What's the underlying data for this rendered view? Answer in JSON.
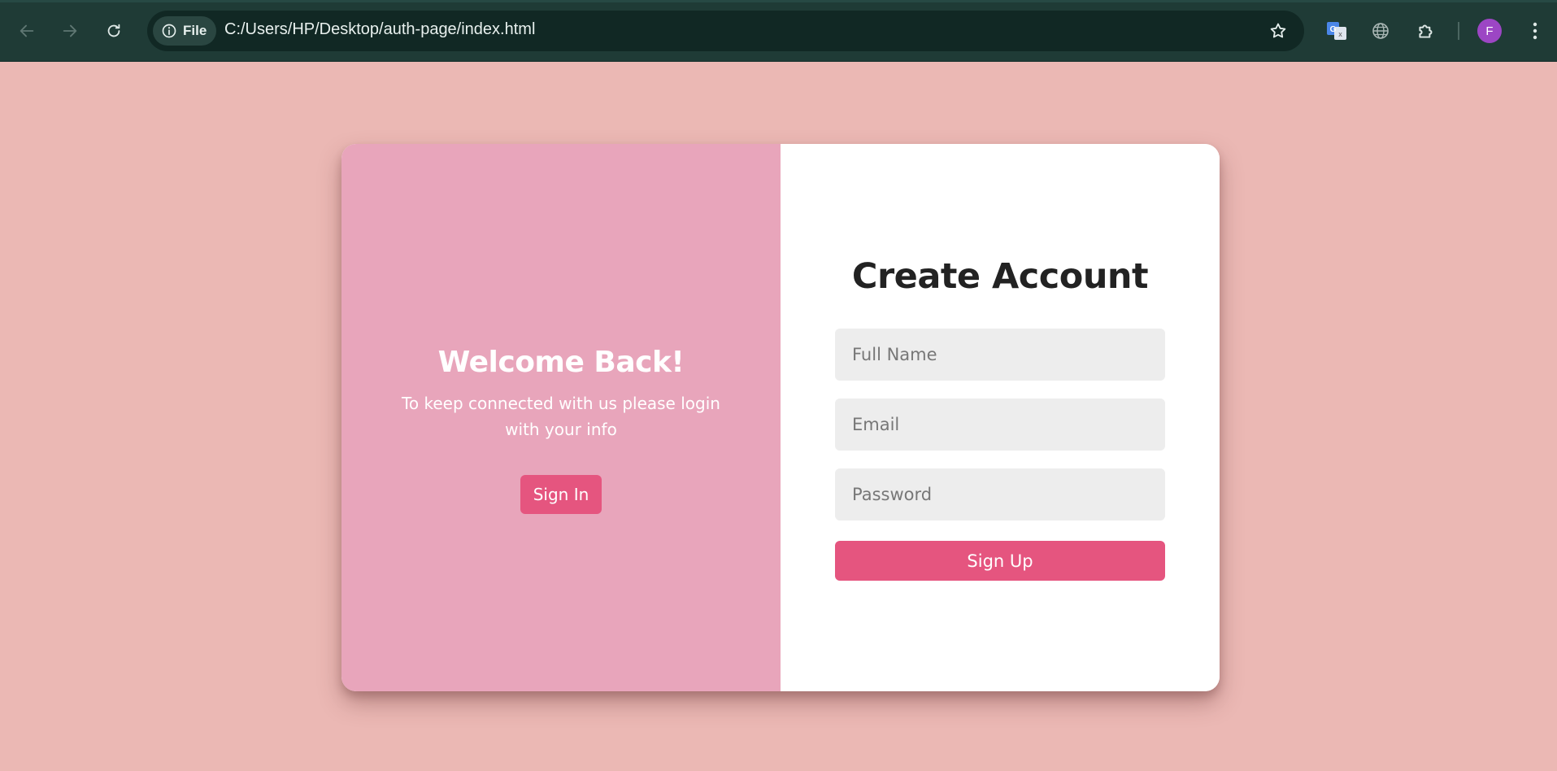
{
  "browser": {
    "site_chip_label": "File",
    "url": "C:/Users/HP/Desktop/auth-page/index.html",
    "profile_initial": "F"
  },
  "colors": {
    "page_background": "#ebb8b4",
    "left_panel": "#e8a5bb",
    "accent_button": "#e5557f",
    "input_background": "#ededed"
  },
  "icons": {
    "back": "arrow-left-icon",
    "forward": "arrow-right-icon",
    "reload": "reload-icon",
    "site_info": "info-icon",
    "bookmark": "star-icon",
    "translate": "google-translate-icon",
    "globe": "globe-icon",
    "extensions": "puzzle-icon",
    "menu": "kebab-menu-icon"
  },
  "welcome": {
    "title": "Welcome Back!",
    "text": "To keep connected with us please login with your info",
    "signin_label": "Sign In"
  },
  "signup": {
    "title": "Create Account",
    "name_placeholder": "Full Name",
    "email_placeholder": "Email",
    "password_placeholder": "Password",
    "signup_label": "Sign Up"
  }
}
